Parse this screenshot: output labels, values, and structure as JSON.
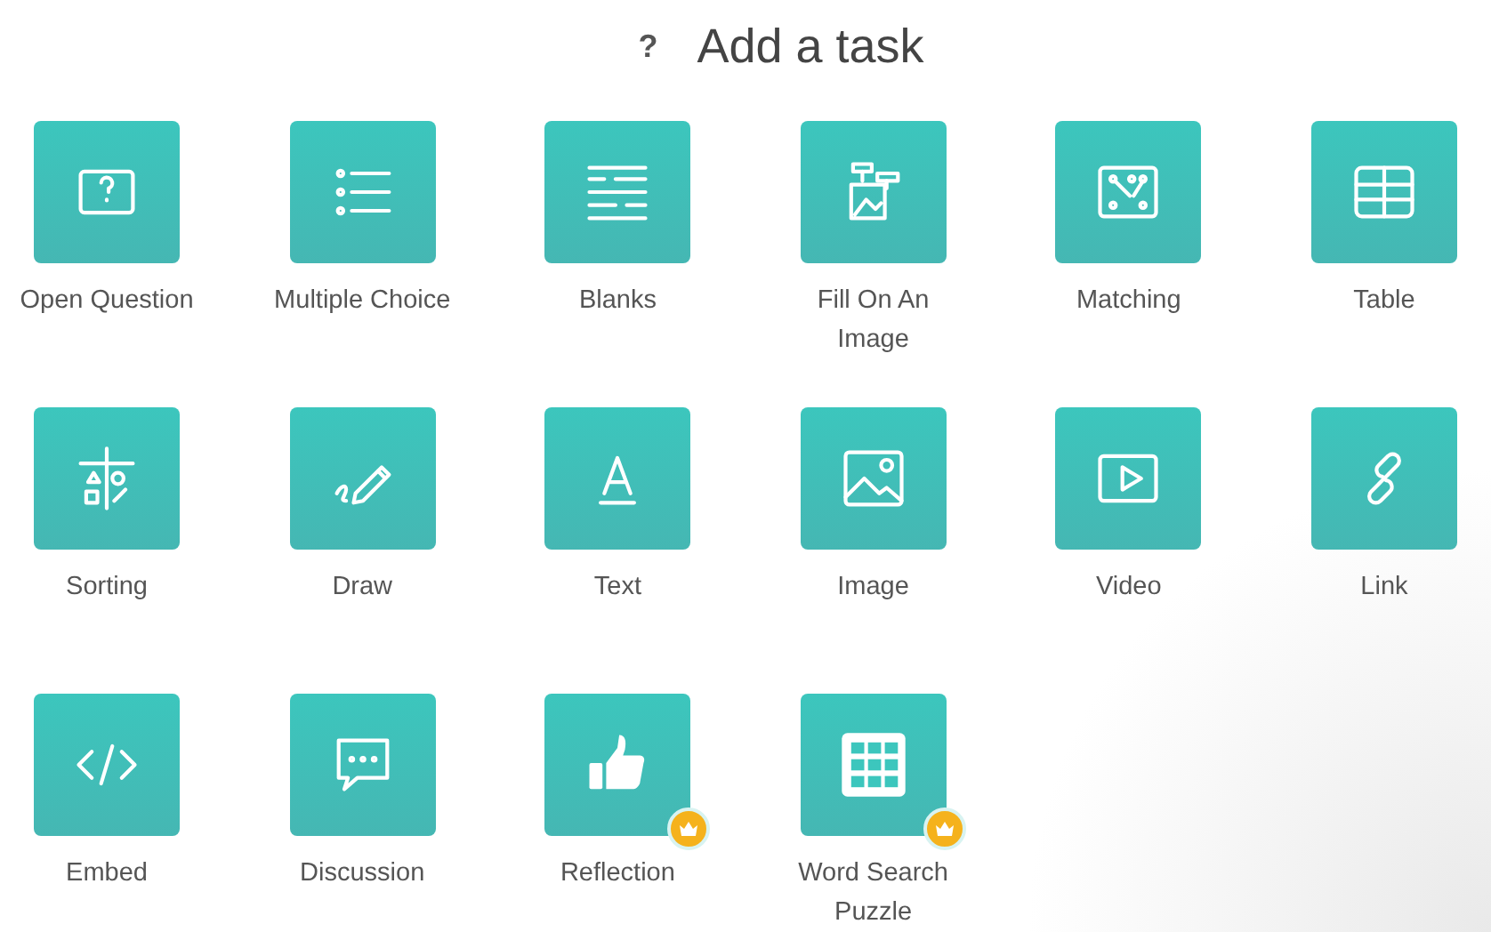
{
  "header": {
    "icon": "?",
    "title": "Add a task"
  },
  "tasks": [
    {
      "kind": "open-question",
      "label": "Open Question",
      "premium": false
    },
    {
      "kind": "multiple-choice",
      "label": "Multiple Choice",
      "premium": false
    },
    {
      "kind": "blanks",
      "label": "Blanks",
      "premium": false
    },
    {
      "kind": "fill-image",
      "label": "Fill On An Image",
      "premium": false
    },
    {
      "kind": "matching",
      "label": "Matching",
      "premium": false
    },
    {
      "kind": "table",
      "label": "Table",
      "premium": false
    },
    {
      "kind": "sorting",
      "label": "Sorting",
      "premium": false
    },
    {
      "kind": "draw",
      "label": "Draw",
      "premium": false
    },
    {
      "kind": "text",
      "label": "Text",
      "premium": false
    },
    {
      "kind": "image",
      "label": "Image",
      "premium": false
    },
    {
      "kind": "video",
      "label": "Video",
      "premium": false
    },
    {
      "kind": "link",
      "label": "Link",
      "premium": false
    },
    {
      "kind": "embed",
      "label": "Embed",
      "premium": false
    },
    {
      "kind": "discussion",
      "label": "Discussion",
      "premium": false
    },
    {
      "kind": "reflection",
      "label": "Reflection",
      "premium": true
    },
    {
      "kind": "word-search",
      "label": "Word Search Puzzle",
      "premium": true
    }
  ]
}
